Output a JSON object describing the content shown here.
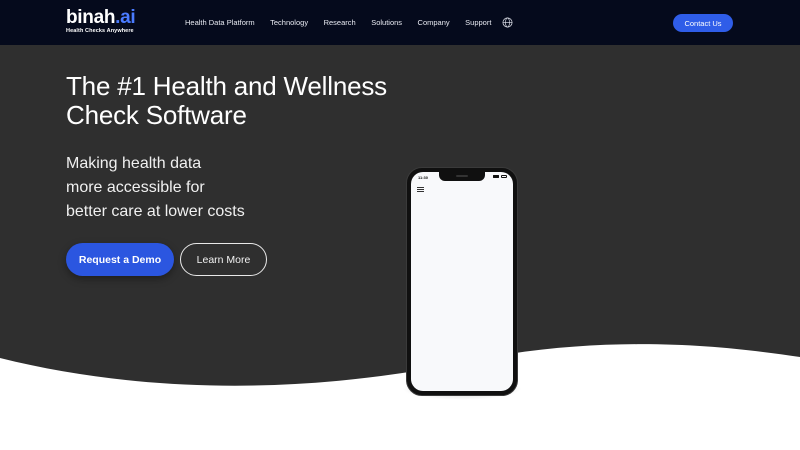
{
  "brand": {
    "name": "binah",
    "suffix": ".ai",
    "tagline": "Health Checks Anywhere"
  },
  "nav": {
    "items": [
      {
        "label": "Health Data Platform"
      },
      {
        "label": "Technology"
      },
      {
        "label": "Research"
      },
      {
        "label": "Solutions"
      },
      {
        "label": "Company"
      },
      {
        "label": "Support"
      }
    ],
    "globe_icon": "globe-icon",
    "contact_label": "Contact Us"
  },
  "hero": {
    "headline_line1": "The #1 Health and Wellness",
    "headline_line2": "Check Software",
    "subline_line1": "Making health data",
    "subline_line2": "more accessible for",
    "subline_line3": "better care at lower costs",
    "primary_cta": "Request a Demo",
    "secondary_cta": "Learn More"
  },
  "phone": {
    "time": "11:30",
    "menu_icon": "hamburger-menu-icon"
  },
  "colors": {
    "nav_bg": "#050a1c",
    "hero_bg": "#2f2f2f",
    "accent": "#2b56e0",
    "brand_ai": "#4a7bff"
  }
}
